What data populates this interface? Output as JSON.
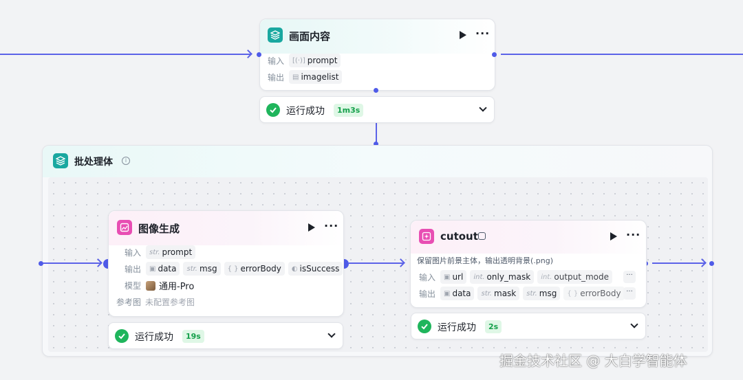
{
  "colors": {
    "canvas_bg": "#f2f3f5",
    "edge": "#5b62e8",
    "success": "#1fb55c",
    "teal_icon": "#19a8a0",
    "pink_icon": "#e84eb3"
  },
  "node_top": {
    "icon": "layers-icon",
    "title": "画面内容",
    "input_label": "输入",
    "input_param": {
      "type_icon": "list-icon",
      "type_prefix": "[(·)]",
      "name": "prompt"
    },
    "output_label": "输出",
    "output_param": {
      "type_icon": "image-list-icon",
      "type_prefix": "▤",
      "name": "imagelist"
    },
    "status": {
      "text": "运行成功",
      "time": "1m3s"
    }
  },
  "batch": {
    "icon": "layers-icon",
    "title": "批处理体",
    "info_icon": "info-icon"
  },
  "node_image": {
    "icon": "image-gen-icon",
    "title": "图像生成",
    "input_label": "输入",
    "inputs": [
      {
        "prefix": "str.",
        "name": "prompt"
      }
    ],
    "output_label": "输出",
    "outputs": [
      {
        "prefix": "▣",
        "name": "data"
      },
      {
        "prefix": "str.",
        "name": "msg"
      },
      {
        "prefix": "{ }",
        "name": "errorBody"
      },
      {
        "prefix": "◐",
        "name": "isSuccess"
      }
    ],
    "model_label": "模型",
    "model_value": "通用-Pro",
    "ref_label": "参考图",
    "ref_value": "未配置参考图",
    "status": {
      "text": "运行成功",
      "time": "19s"
    }
  },
  "node_cutout": {
    "icon": "sparkle-icon",
    "title": "cutout",
    "desc": "保留图片前景主体，输出透明背景(.png)",
    "input_label": "输入",
    "inputs": [
      {
        "prefix": "▣",
        "name": "url"
      },
      {
        "prefix": "int.",
        "name": "only_mask"
      },
      {
        "prefix": "int.",
        "name": "output_mode"
      }
    ],
    "output_label": "输出",
    "outputs": [
      {
        "prefix": "▣",
        "name": "data"
      },
      {
        "prefix": "str.",
        "name": "mask"
      },
      {
        "prefix": "str.",
        "name": "msg"
      },
      {
        "prefix": "{ }",
        "name": "errorBody"
      }
    ],
    "more": "···",
    "status": {
      "text": "运行成功",
      "time": "2s"
    }
  },
  "watermark": "掘金技术社区 @ 大白学智能体"
}
